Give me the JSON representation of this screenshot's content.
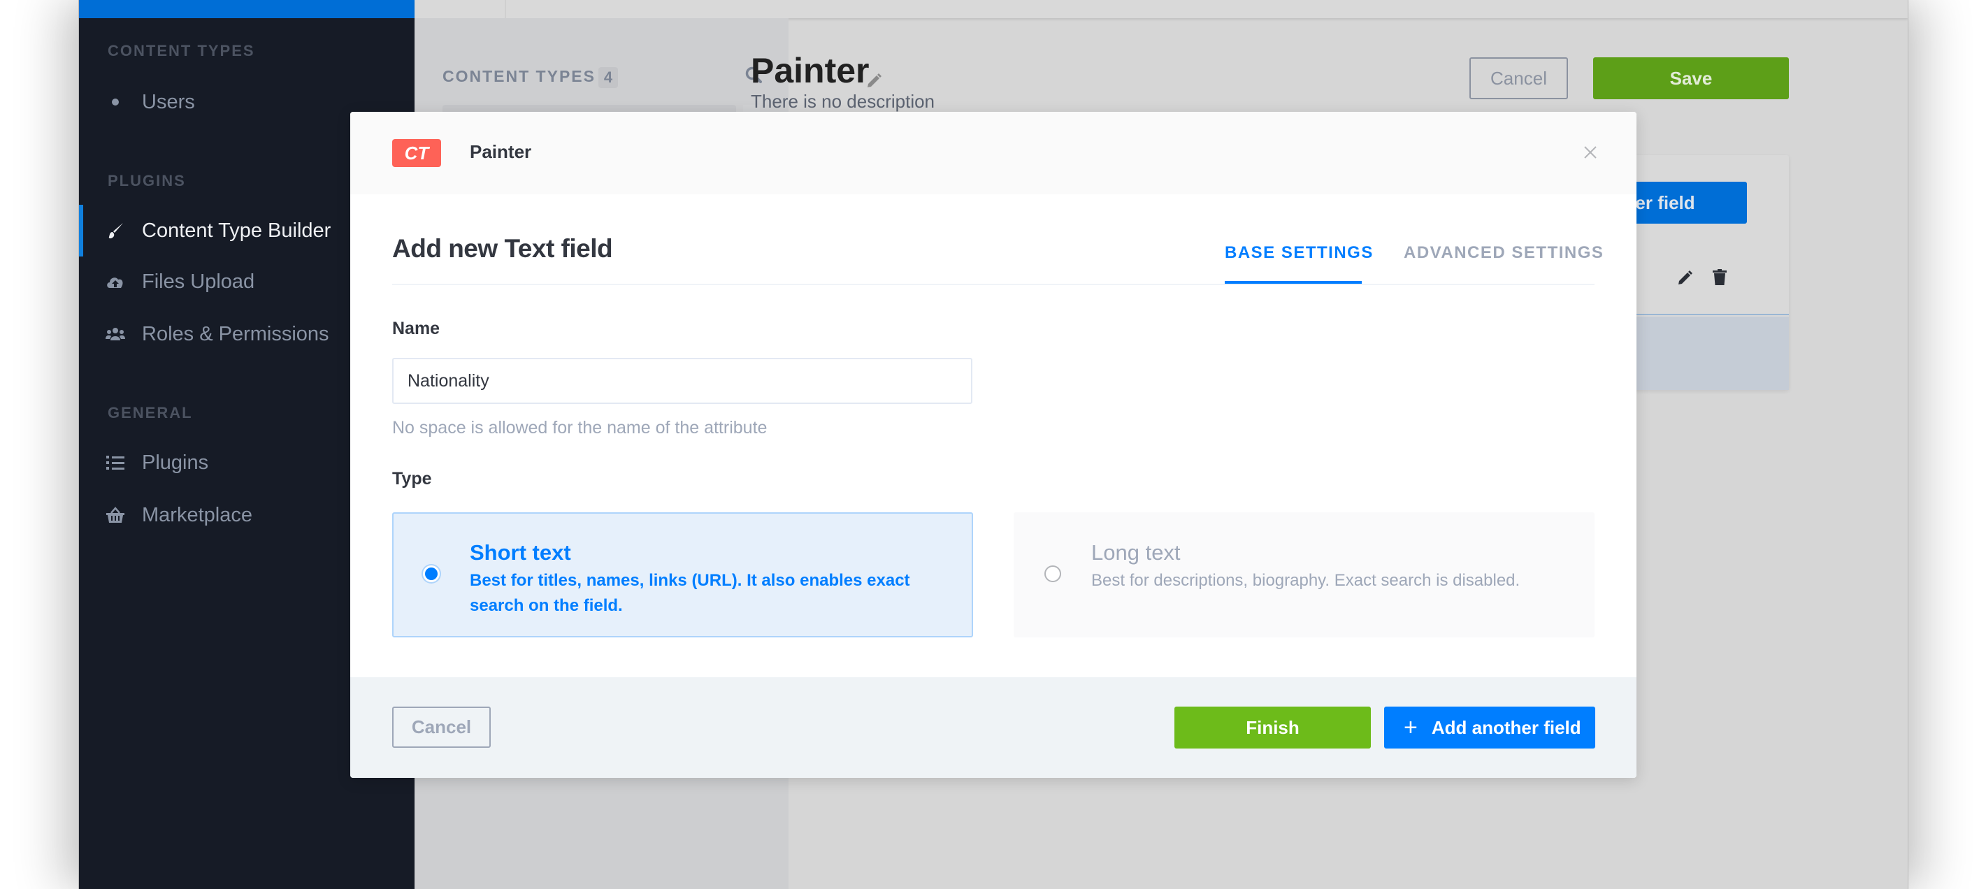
{
  "colors": {
    "sidebar_bg": "#161b26",
    "brand_blue": "#007eff",
    "success_green": "#6dbb1a",
    "ct_badge_red": "#fe6257"
  },
  "sidebar": {
    "sections": [
      {
        "title": "CONTENT TYPES",
        "items": [
          {
            "label": "Users",
            "icon": "bullet-icon"
          }
        ]
      },
      {
        "title": "PLUGINS",
        "items": [
          {
            "label": "Content Type Builder",
            "icon": "paintbrush-icon",
            "active": true
          },
          {
            "label": "Files Upload",
            "icon": "cloud-upload-icon"
          },
          {
            "label": "Roles & Permissions",
            "icon": "users-icon"
          }
        ]
      },
      {
        "title": "GENERAL",
        "items": [
          {
            "label": "Plugins",
            "icon": "list-icon"
          },
          {
            "label": "Marketplace",
            "icon": "basket-icon"
          }
        ]
      }
    ]
  },
  "content_types_panel": {
    "title": "CONTENT TYPES",
    "count": "4",
    "search_icon": "search-icon"
  },
  "page": {
    "title": "Painter",
    "description": "There is no description",
    "cancel_label": "Cancel",
    "save_label": "Save",
    "add_field_label": "Add another field"
  },
  "modal": {
    "badge": "CT",
    "content_type": "Painter",
    "title": "Add new Text field",
    "tabs": [
      {
        "label": "BASE SETTINGS",
        "active": true
      },
      {
        "label": "ADVANCED SETTINGS",
        "active": false
      }
    ],
    "name_label": "Name",
    "name_value": "Nationality",
    "name_hint": "No space is allowed for the name of the attribute",
    "type_label": "Type",
    "types": [
      {
        "title": "Short text",
        "description": "Best for titles, names, links (URL). It also enables exact search on the field.",
        "selected": true
      },
      {
        "title": "Long text",
        "description": "Best for descriptions, biography. Exact search is disabled.",
        "selected": false
      }
    ],
    "footer": {
      "cancel_label": "Cancel",
      "finish_label": "Finish",
      "add_label": "Add another field"
    }
  }
}
